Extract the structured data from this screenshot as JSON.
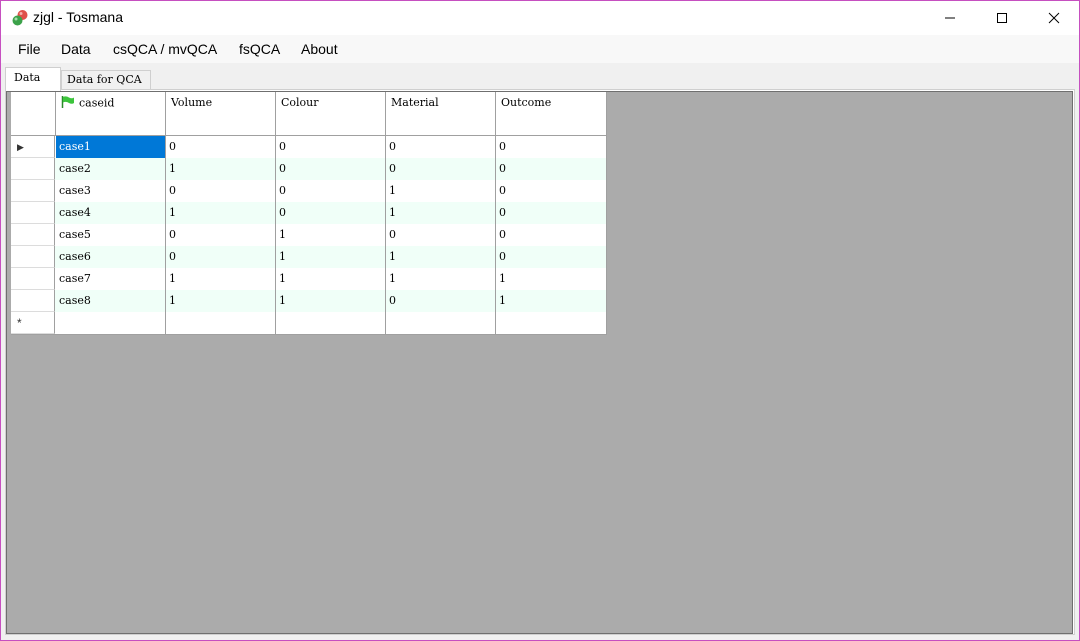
{
  "window": {
    "title": "zjgl - Tosmana"
  },
  "menu": {
    "items": [
      "File",
      "Data",
      "csQCA / mvQCA",
      "fsQCA",
      "About"
    ]
  },
  "tabs": [
    "Data",
    "Data for QCA"
  ],
  "grid": {
    "columns": [
      "caseid",
      "Volume",
      "Colour",
      "Material",
      "Outcome"
    ],
    "rows": [
      [
        "case1",
        "0",
        "0",
        "0",
        "0"
      ],
      [
        "case2",
        "1",
        "0",
        "0",
        "0"
      ],
      [
        "case3",
        "0",
        "0",
        "1",
        "0"
      ],
      [
        "case4",
        "1",
        "0",
        "1",
        "0"
      ],
      [
        "case5",
        "0",
        "1",
        "0",
        "0"
      ],
      [
        "case6",
        "0",
        "1",
        "1",
        "0"
      ],
      [
        "case7",
        "1",
        "1",
        "1",
        "1"
      ],
      [
        "case8",
        "1",
        "1",
        "0",
        "1"
      ]
    ],
    "current_row_marker": "▶",
    "new_row_marker": "*",
    "selected_cell": "case1",
    "colors": {
      "alt_row": "#f0fff8",
      "row": "#ffffff",
      "selection": "#0078d7",
      "empty_area": "#ababab"
    }
  }
}
